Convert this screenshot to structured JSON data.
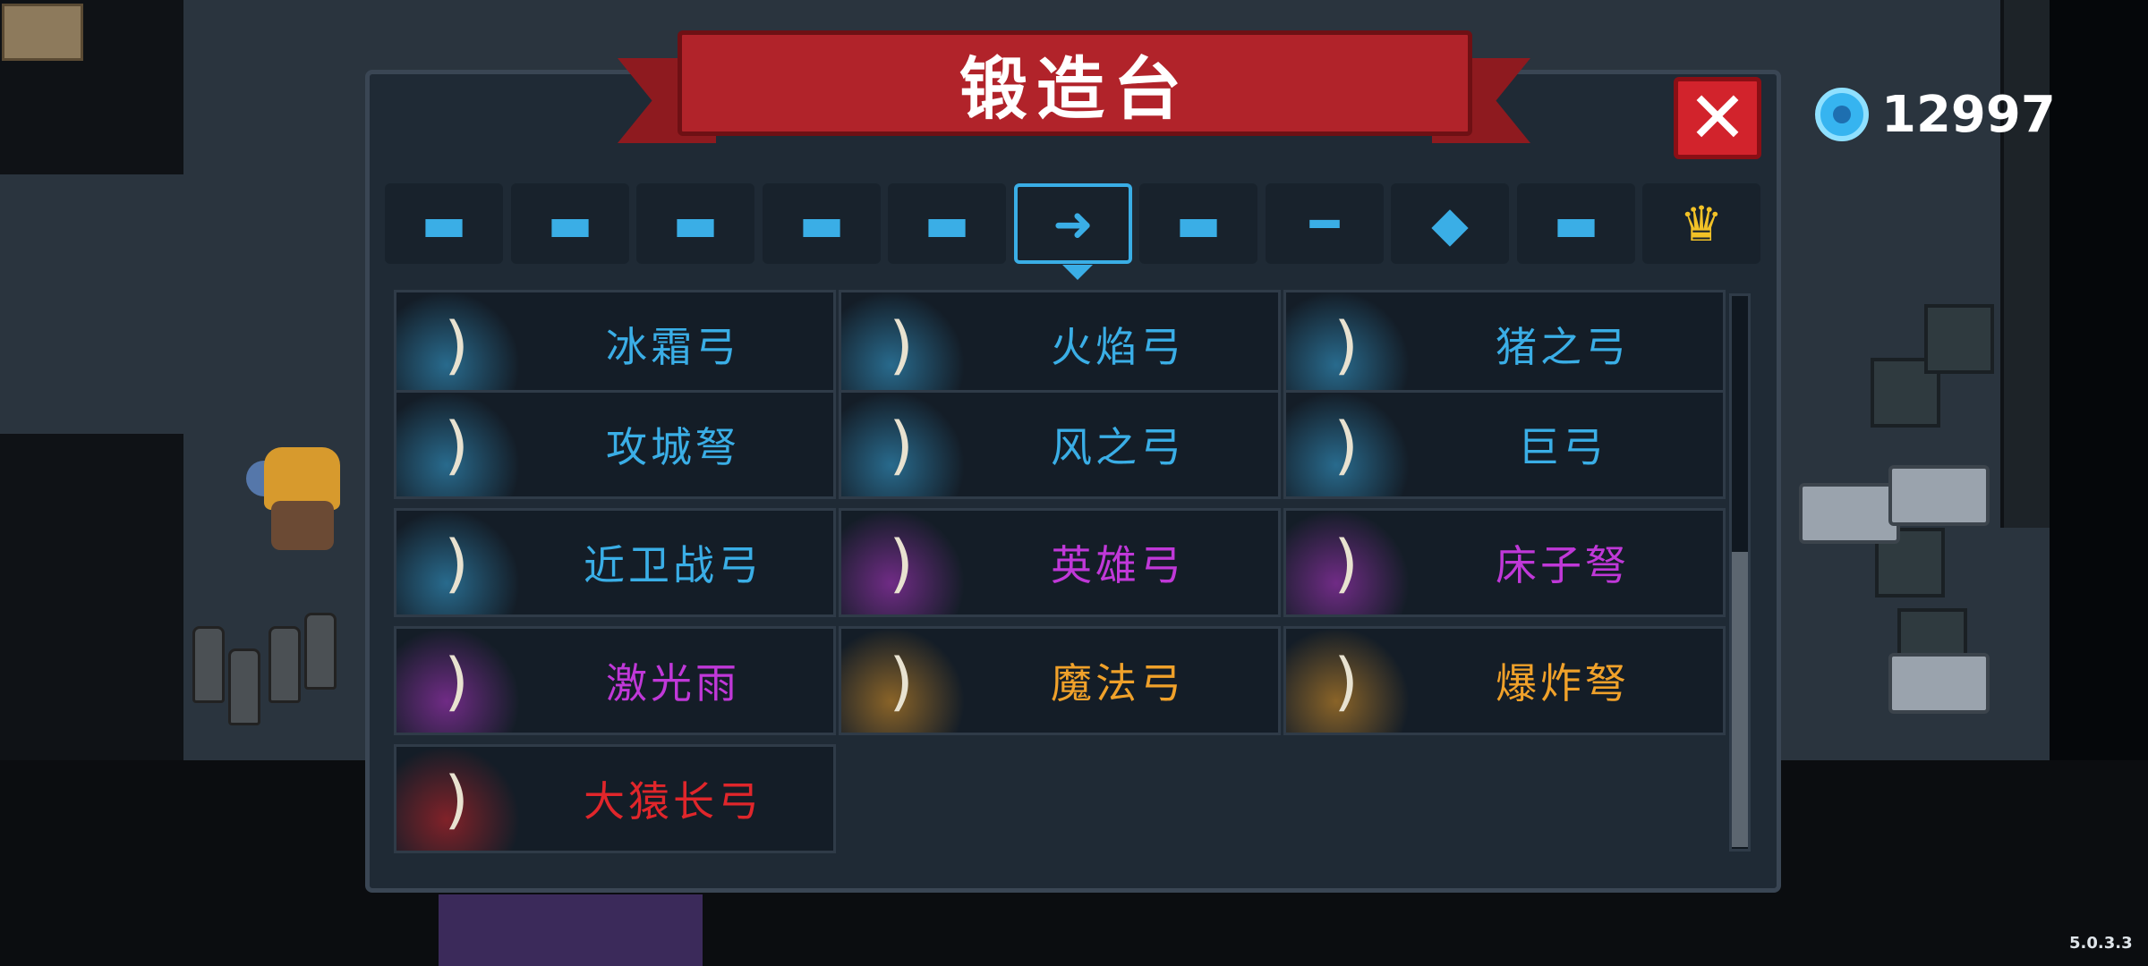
{
  "title": "锻造台",
  "close_symbol": "✕",
  "currency": {
    "icon": "gem-icon",
    "amount": "12997"
  },
  "version": "5.0.3.3",
  "colors": {
    "blue": "#3aaee6",
    "purple": "#c038d8",
    "orange": "#f0a12a",
    "red": "#e0262b"
  },
  "category_tabs": [
    {
      "icon": "pistol-icon",
      "glyph": "▬"
    },
    {
      "icon": "rifle-icon",
      "glyph": "▬"
    },
    {
      "icon": "shotgun-icon",
      "glyph": "▬"
    },
    {
      "icon": "launcher-icon",
      "glyph": "▬"
    },
    {
      "icon": "laser-gun-icon",
      "glyph": "▬"
    },
    {
      "icon": "bow-icon",
      "glyph": "➜"
    },
    {
      "icon": "sword-icon",
      "glyph": "▬"
    },
    {
      "icon": "spear-icon",
      "glyph": "━"
    },
    {
      "icon": "shuriken-icon",
      "glyph": "◆"
    },
    {
      "icon": "fish-icon",
      "glyph": "▬"
    },
    {
      "icon": "crown-icon",
      "glyph": "♛"
    }
  ],
  "items": [
    {
      "name": "冰霜弓",
      "rarity": "blue"
    },
    {
      "name": "火焰弓",
      "rarity": "blue"
    },
    {
      "name": "猪之弓",
      "rarity": "blue"
    },
    {
      "name": "攻城弩",
      "rarity": "blue"
    },
    {
      "name": "风之弓",
      "rarity": "blue"
    },
    {
      "name": "巨弓",
      "rarity": "blue"
    },
    {
      "name": "近卫战弓",
      "rarity": "blue"
    },
    {
      "name": "英雄弓",
      "rarity": "purple"
    },
    {
      "name": "床子弩",
      "rarity": "purple"
    },
    {
      "name": "激光雨",
      "rarity": "purple"
    },
    {
      "name": "魔法弓",
      "rarity": "orange"
    },
    {
      "name": "爆炸弩",
      "rarity": "orange"
    },
    {
      "name": "大猿长弓",
      "rarity": "red"
    }
  ]
}
